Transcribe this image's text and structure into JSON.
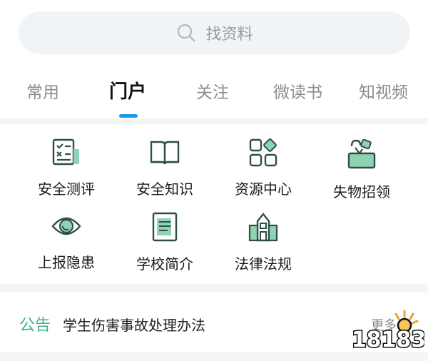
{
  "search": {
    "placeholder": "找资料"
  },
  "tabs": [
    {
      "label": "常用"
    },
    {
      "label": "门户",
      "active": true
    },
    {
      "label": "关注"
    },
    {
      "label": "微读书"
    },
    {
      "label": "知视频"
    }
  ],
  "grid": [
    {
      "label": "安全测评",
      "icon": "checklist-icon"
    },
    {
      "label": "安全知识",
      "icon": "book-icon"
    },
    {
      "label": "资源中心",
      "icon": "apps-grid-icon"
    },
    {
      "label": "失物招领",
      "icon": "lost-found-box-icon"
    },
    {
      "label": "上报隐患",
      "icon": "eye-icon"
    },
    {
      "label": "学校简介",
      "icon": "document-icon"
    },
    {
      "label": "法律法规",
      "icon": "building-icon"
    }
  ],
  "notice": {
    "tag": "公告",
    "text": "学生伤害事故处理办法",
    "more": "更多"
  },
  "watermark": {
    "text": "18183"
  },
  "colors": {
    "accent_green": "#3fb08a",
    "tab_indicator": "#1f9be4",
    "icon_dark": "#2f4f44",
    "icon_light": "#8fd3b4"
  }
}
